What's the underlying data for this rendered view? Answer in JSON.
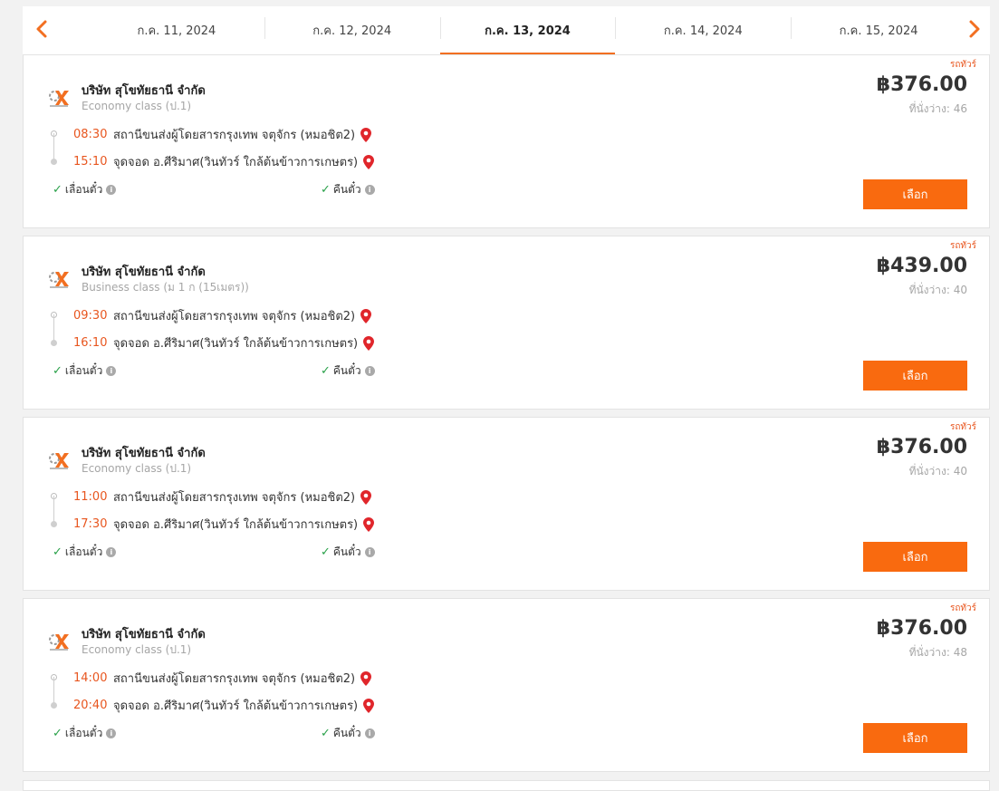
{
  "date_bar": {
    "dates": [
      "ก.ค. 11, 2024",
      "ก.ค. 12, 2024",
      "ก.ค. 13, 2024",
      "ก.ค. 14, 2024",
      "ก.ค. 15, 2024"
    ],
    "active_index": 2,
    "prev_icon": "chevron-left-icon",
    "next_icon": "chevron-right-icon",
    "accent_color": "#f26f21"
  },
  "trips": [
    {
      "bus_type": "รถทัวร์",
      "company": "บริษัท สุโขทัยธานี จำกัด",
      "seat_class": "Economy class (ป.1)",
      "departure_time": "08:30",
      "departure_station": "สถานีขนส่งผู้โดยสารกรุงเทพ จตุจักร (หมอชิต2)",
      "arrival_time": "15:10",
      "arrival_station": "จุดจอด อ.ศีริมาศ(วินทัวร์ ใกล้ต้นข้าวการเกษตร)",
      "reschedule_label": "เลื่อนตั๋ว",
      "refund_label": "คืนตั๋ว",
      "price": "฿376.00",
      "seats_label": "ที่นั่งว่าง: 46",
      "select_label": "เลือก"
    },
    {
      "bus_type": "รถทัวร์",
      "company": "บริษัท สุโขทัยธานี จำกัด",
      "seat_class": "Business class (ม 1 ก (15เมตร))",
      "departure_time": "09:30",
      "departure_station": "สถานีขนส่งผู้โดยสารกรุงเทพ จตุจักร (หมอชิต2)",
      "arrival_time": "16:10",
      "arrival_station": "จุดจอด อ.ศีริมาศ(วินทัวร์ ใกล้ต้นข้าวการเกษตร)",
      "reschedule_label": "เลื่อนตั๋ว",
      "refund_label": "คืนตั๋ว",
      "price": "฿439.00",
      "seats_label": "ที่นั่งว่าง: 40",
      "select_label": "เลือก"
    },
    {
      "bus_type": "รถทัวร์",
      "company": "บริษัท สุโขทัยธานี จำกัด",
      "seat_class": "Economy class (ป.1)",
      "departure_time": "11:00",
      "departure_station": "สถานีขนส่งผู้โดยสารกรุงเทพ จตุจักร (หมอชิต2)",
      "arrival_time": "17:30",
      "arrival_station": "จุดจอด อ.ศีริมาศ(วินทัวร์ ใกล้ต้นข้าวการเกษตร)",
      "reschedule_label": "เลื่อนตั๋ว",
      "refund_label": "คืนตั๋ว",
      "price": "฿376.00",
      "seats_label": "ที่นั่งว่าง: 40",
      "select_label": "เลือก"
    },
    {
      "bus_type": "รถทัวร์",
      "company": "บริษัท สุโขทัยธานี จำกัด",
      "seat_class": "Economy class (ป.1)",
      "departure_time": "14:00",
      "departure_station": "สถานีขนส่งผู้โดยสารกรุงเทพ จตุจักร (หมอชิต2)",
      "arrival_time": "20:40",
      "arrival_station": "จุดจอด อ.ศีริมาศ(วินทัวร์ ใกล้ต้นข้าวการเกษตร)",
      "reschedule_label": "เลื่อนตั๋ว",
      "refund_label": "คืนตั๋ว",
      "price": "฿376.00",
      "seats_label": "ที่นั่งว่าง: 48",
      "select_label": "เลือก"
    }
  ]
}
